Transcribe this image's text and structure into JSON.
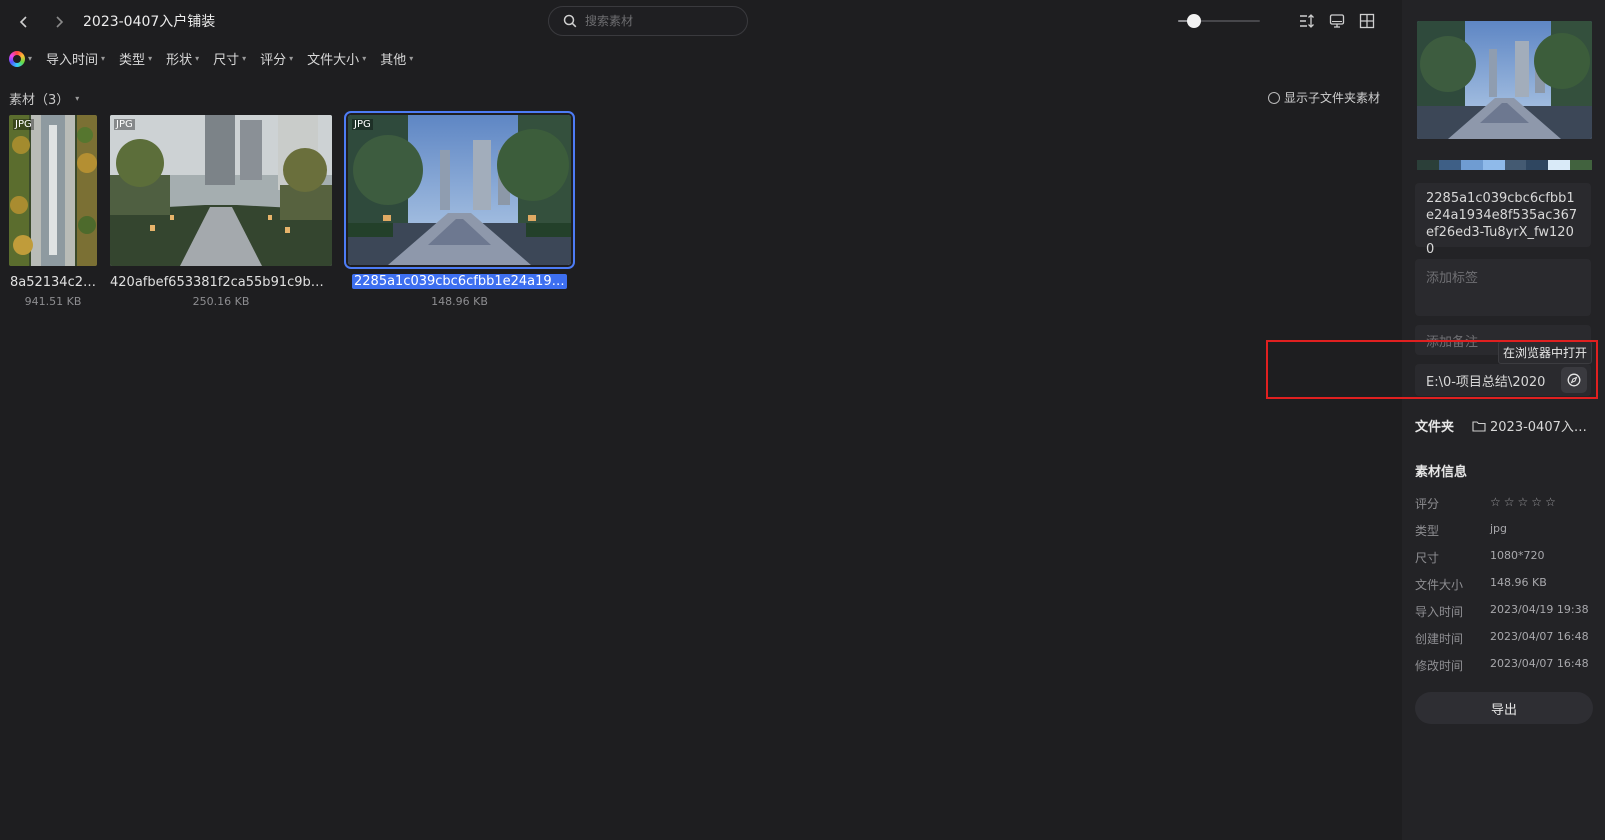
{
  "toolbar": {
    "back_icon": "chevron-left-icon",
    "forward_icon": "chevron-right-icon",
    "title": "2023-0407入户铺装",
    "search_placeholder": "搜索素材",
    "zoom_level": 0.2
  },
  "filters": {
    "items": [
      {
        "label": "导入时间"
      },
      {
        "label": "类型"
      },
      {
        "label": "形状"
      },
      {
        "label": "尺寸"
      },
      {
        "label": "评分"
      },
      {
        "label": "文件大小"
      },
      {
        "label": "其他"
      }
    ]
  },
  "grid": {
    "section_label": "素材（3）",
    "show_subfolder_label": "显示子文件夹素材",
    "items": [
      {
        "badge": "JPG",
        "name": "8a52134c2…",
        "size": "941.51 KB"
      },
      {
        "badge": "JPG",
        "name": "420afbef653381f2ca55b91c9b5c5…",
        "size": "250.16 KB"
      },
      {
        "badge": "JPG",
        "name": "2285a1c039cbc6cfbb1e24a1934…",
        "size": "148.96 KB"
      }
    ]
  },
  "inspector": {
    "palette": [
      "#2b3f39",
      "#3e5f86",
      "#6f9cd2",
      "#8fbaea",
      "#445a72",
      "#2f4660",
      "#d9eaf8",
      "#41623e"
    ],
    "filename": "2285a1c039cbc6cfbb1e24a1934e8f535ac367ef26ed3-Tu8yrX_fw1200",
    "tags_placeholder": "添加标签",
    "notes_placeholder": "添加备注",
    "path": "E:\\0-项目总结\\2020",
    "open_in_browser_tooltip": "在浏览器中打开",
    "folder_label": "文件夹",
    "folder_value": "2023-0407入…",
    "info_title": "素材信息",
    "rating_label": "评分",
    "rating_value": 0,
    "type_label": "类型",
    "type_value": "jpg",
    "dimension_label": "尺寸",
    "dimension_value": "1080*720",
    "filesize_label": "文件大小",
    "filesize_value": "148.96 KB",
    "import_time_label": "导入时间",
    "import_time_value": "2023/04/19 19:38",
    "created_label": "创建时间",
    "created_value": "2023/04/07 16:48",
    "modified_label": "修改时间",
    "modified_value": "2023/04/07 16:48",
    "export_label": "导出"
  }
}
